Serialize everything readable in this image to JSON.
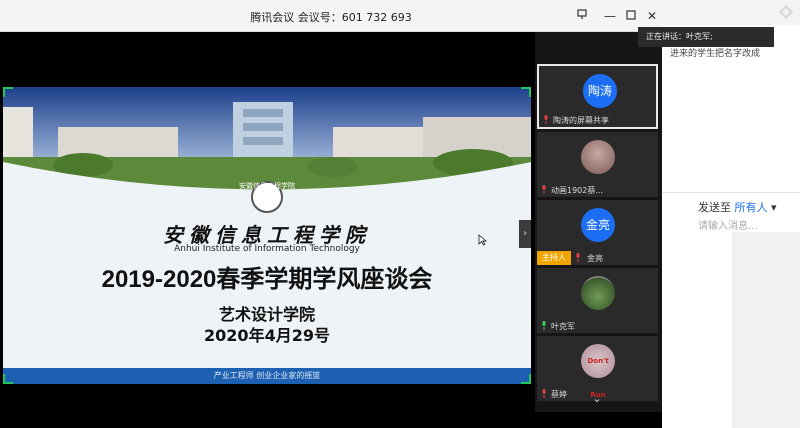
{
  "window": {
    "title": "腾讯会议  会议号：601 732 693"
  },
  "stage": {
    "slide": {
      "logo_caption": "安徽信息工程学院",
      "calligraphy": "安徽信息工程学院",
      "english_name": "Anhui Institute of Information Technology",
      "main_title": "2019-2020春季学期学风座谈会",
      "department": "艺术设计学院",
      "date": "2020年4月29号",
      "footer": "产业工程师  创业企业家的摇篮"
    }
  },
  "participants": [
    {
      "name": "陶涛的屏幕共享",
      "avatar_text": "陶涛",
      "active": true,
      "host": false
    },
    {
      "name": "动画1902蔡...",
      "avatar_text": "",
      "active": false,
      "host": false
    },
    {
      "name": "金亮",
      "avatar_text": "金亮",
      "active": false,
      "host": true,
      "host_label": "主持人"
    },
    {
      "name": "叶克军",
      "avatar_text": "",
      "active": false,
      "host": false
    },
    {
      "name": "蔡婷",
      "avatar_text": "Don't Run",
      "active": false,
      "host": false
    }
  ],
  "chat": {
    "speaking": "正在讲话：叶克军;",
    "message": "进来的学生把名字改成",
    "send_to_label": "发送至",
    "send_to_value": "所有人",
    "input_placeholder": "请输入消息..."
  },
  "colors": {
    "accent": "#1b6ef3",
    "host_badge": "#f0a500",
    "share_border": "#20c95a"
  }
}
